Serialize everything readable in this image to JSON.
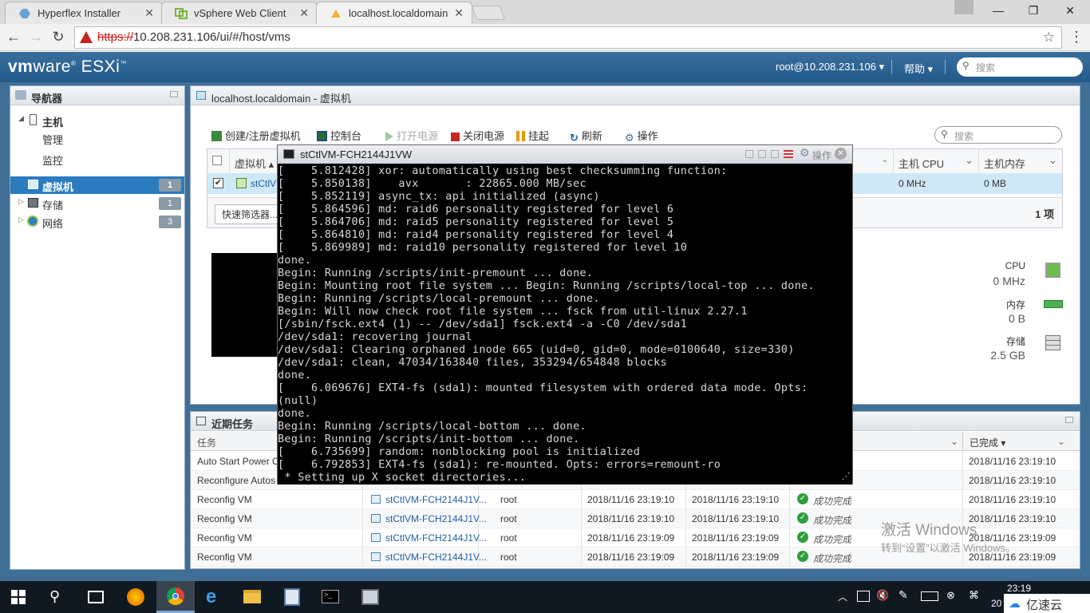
{
  "browser": {
    "tabs": [
      {
        "label": "Hyperflex Installer",
        "icon": "hyperflex-icon"
      },
      {
        "label": "vSphere Web Client",
        "icon": "vsphere-icon"
      },
      {
        "label": "localhost.localdomain",
        "icon": "esxi-icon",
        "active": true
      }
    ],
    "url_scheme": "https://",
    "url_rest": "10.208.231.106/ui/#/host/vms"
  },
  "esxi": {
    "logo_vm": "vm",
    "logo_ware": "ware",
    "logo_esxi": "ESXi",
    "user": "root@10.208.231.106 ▾",
    "help": "帮助 ▾",
    "search_placeholder": "搜索"
  },
  "navigator": {
    "title": "导航器",
    "items": [
      {
        "label": "主机",
        "level": 0,
        "icon": "host-icon"
      },
      {
        "label": "管理",
        "level": 1
      },
      {
        "label": "监控",
        "level": 1
      },
      {
        "label": "虚拟机",
        "level": 0,
        "selected": true,
        "count": "1",
        "icon": "vm-icon"
      },
      {
        "label": "存储",
        "level": 0,
        "count": "1",
        "icon": "storage-icon"
      },
      {
        "label": "网络",
        "level": 0,
        "count": "3",
        "icon": "network-icon"
      }
    ]
  },
  "main": {
    "title": "localhost.localdomain - 虚拟机",
    "toolbar": [
      {
        "label": "创建/注册虚拟机",
        "icon": "create-vm-icon",
        "color": "#3a8a3a",
        "enabled": true
      },
      {
        "label": "控制台",
        "icon": "console-icon",
        "color": "#2c6e2c",
        "enabled": true
      },
      {
        "label": "打开电源",
        "icon": "power-on-icon",
        "color": "#9ccc9c",
        "enabled": false
      },
      {
        "label": "关闭电源",
        "icon": "power-off-icon",
        "color": "#c62828",
        "enabled": true
      },
      {
        "label": "挂起",
        "icon": "suspend-icon",
        "color": "#e69a00",
        "enabled": true
      },
      {
        "label": "刷新",
        "icon": "refresh-icon",
        "color": "#1f6fb5",
        "enabled": true
      },
      {
        "label": "操作",
        "icon": "gear-icon",
        "color": "#3f6f97",
        "enabled": true
      }
    ],
    "search_placeholder": "搜索",
    "columns": {
      "vm": "虚拟机 ▴",
      "cpu": "主机 CPU",
      "mem": "主机内存"
    },
    "row": {
      "name": "stCtlV",
      "cpu": "0 MHz",
      "mem": "0 MB"
    },
    "quick_filter": "快速筛选器...",
    "count": "1 项",
    "stats": [
      {
        "label": "CPU",
        "value": "0 MHz",
        "icon": "cpu-icon"
      },
      {
        "label": "内存",
        "value": "0 B",
        "icon": "memory-icon"
      },
      {
        "label": "存储",
        "value": "2.5 GB",
        "icon": "storage-icon"
      }
    ]
  },
  "console": {
    "title": "stCtlVM-FCH2144J1VW",
    "actions": "操作",
    "lines": [
      "[    5.812428] xor: automatically using best checksumming function:",
      "[    5.850138]    avx       : 22865.000 MB/sec",
      "[    5.852119] async_tx: api initialized (async)",
      "[    5.864596] md: raid6 personality registered for level 6",
      "[    5.864706] md: raid5 personality registered for level 5",
      "[    5.864810] md: raid4 personality registered for level 4",
      "[    5.869989] md: raid10 personality registered for level 10",
      "done.",
      "Begin: Running /scripts/init-premount ... done.",
      "Begin: Mounting root file system ... Begin: Running /scripts/local-top ... done.",
      "Begin: Running /scripts/local-premount ... done.",
      "Begin: Will now check root file system ... fsck from util-linux 2.27.1",
      "[/sbin/fsck.ext4 (1) -- /dev/sda1] fsck.ext4 -a -C0 /dev/sda1",
      "/dev/sda1: recovering journal",
      "/dev/sda1: Clearing orphaned inode 665 (uid=0, gid=0, mode=0100640, size=330)",
      "/dev/sda1: clean, 47034/163840 files, 353294/654848 blocks",
      "done.",
      "[    6.069676] EXT4-fs (sda1): mounted filesystem with ordered data mode. Opts:",
      "(null)",
      "done.",
      "Begin: Running /scripts/local-bottom ... done.",
      "Begin: Running /scripts/init-bottom ... done.",
      "[    6.735699] random: nonblocking pool is initialized",
      "[    6.792853] EXT4-fs (sda1): re-mounted. Opts: errors=remount-ro",
      " * Setting up X socket directories..."
    ]
  },
  "tasks": {
    "title": "近期任务",
    "col_task": "任务",
    "col_done": "已完成 ▾",
    "rows": [
      {
        "task": "Auto Start Power O",
        "target": "",
        "user": "",
        "queued": "",
        "started": "",
        "result": "",
        "done": "2018/11/16 23:19:10"
      },
      {
        "task": "Reconfigure Autos",
        "target": "",
        "user": "",
        "queued": "",
        "started": "",
        "result": "",
        "done": "2018/11/16 23:19:10"
      },
      {
        "task": "Reconfig VM",
        "target": "stCtlVM-FCH2144J1V...",
        "user": "root",
        "queued": "2018/11/16 23:19:10",
        "started": "2018/11/16 23:19:10",
        "result": "成功完成",
        "done": "2018/11/16 23:19:10"
      },
      {
        "task": "Reconfig VM",
        "target": "stCtlVM-FCH2144J1V...",
        "user": "root",
        "queued": "2018/11/16 23:19:10",
        "started": "2018/11/16 23:19:10",
        "result": "成功完成",
        "done": "2018/11/16 23:19:10"
      },
      {
        "task": "Reconfig VM",
        "target": "stCtlVM-FCH2144J1V...",
        "user": "root",
        "queued": "2018/11/16 23:19:09",
        "started": "2018/11/16 23:19:09",
        "result": "成功完成",
        "done": "2018/11/16 23:19:09"
      },
      {
        "task": "Reconfig VM",
        "target": "stCtlVM-FCH2144J1V...",
        "user": "root",
        "queued": "2018/11/16 23:19:09",
        "started": "2018/11/16 23:19:09",
        "result": "成功完成",
        "done": "2018/11/16 23:19:09"
      }
    ]
  },
  "watermark": {
    "line1": "激活 Windows",
    "line2": "转到“设置”以激活 Windows。"
  },
  "taskbar": {
    "apps": [
      "firefox-icon",
      "chrome-icon",
      "ie-icon",
      "explorer-icon",
      "server-manager-icon",
      "cmd-icon",
      "vm-console-icon"
    ],
    "clock_time": "23:19",
    "clock_date": "20",
    "brand": "亿速云"
  }
}
